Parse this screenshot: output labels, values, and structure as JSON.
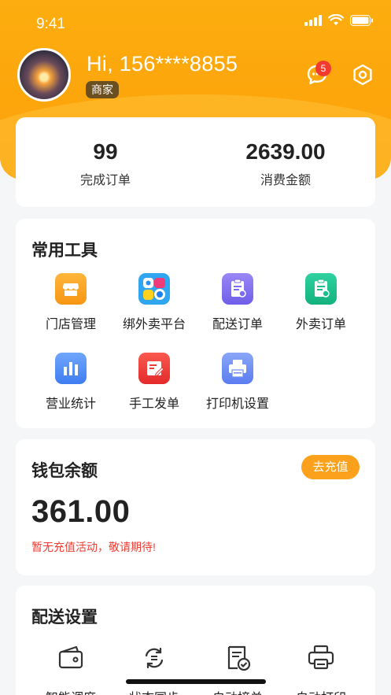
{
  "status_bar": {
    "time": "9:41"
  },
  "profile": {
    "greeting": "Hi, 156****8855",
    "role": "商家",
    "message_count": "5"
  },
  "stats": [
    {
      "value": "99",
      "label": "完成订单"
    },
    {
      "value": "2639.00",
      "label": "消费金额"
    }
  ],
  "tools": {
    "title": "常用工具",
    "items": [
      {
        "label": "门店管理",
        "icon": "store-icon",
        "color": "#fba320"
      },
      {
        "label": "绑外卖平台",
        "icon": "platform-bind-icon",
        "color": "#2f8ef6"
      },
      {
        "label": "配送订单",
        "icon": "delivery-order-icon",
        "color": "#7c6cf0"
      },
      {
        "label": "外卖订单",
        "icon": "takeout-order-icon",
        "color": "#1bbf8b"
      },
      {
        "label": "营业统计",
        "icon": "bar-chart-icon",
        "color": "#4d8cf7"
      },
      {
        "label": "手工发单",
        "icon": "manual-order-icon",
        "color": "#f03a3a"
      },
      {
        "label": "打印机设置",
        "icon": "printer-icon",
        "color": "#6d8ef5"
      }
    ]
  },
  "wallet": {
    "title": "钱包余额",
    "topup_label": "去充值",
    "balance": "361.00",
    "note": "暂无充值活动，敬请期待!"
  },
  "delivery_settings": {
    "title": "配送设置",
    "items": [
      {
        "label": "智能调度",
        "icon": "wallet-icon"
      },
      {
        "label": "状态同步",
        "icon": "sync-icon"
      },
      {
        "label": "自动接单",
        "icon": "auto-accept-icon"
      },
      {
        "label": "自动打印",
        "icon": "printer-icon"
      }
    ]
  }
}
